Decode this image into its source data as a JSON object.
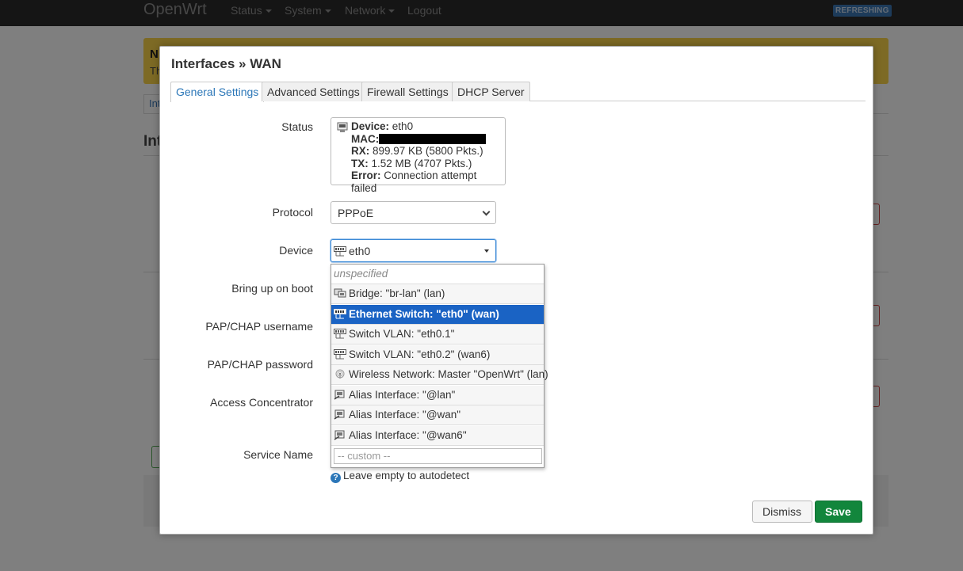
{
  "navbar": {
    "brand": "OpenWrt",
    "items": [
      {
        "label": "Status",
        "has_caret": true
      },
      {
        "label": "System",
        "has_caret": true
      },
      {
        "label": "Network",
        "has_caret": true
      },
      {
        "label": "Logout",
        "has_caret": false
      }
    ],
    "refresh_badge": "REFRESHING"
  },
  "background": {
    "notice_title": "N",
    "notice_text": "Th",
    "tab_label": "Int",
    "heading": "Int"
  },
  "modal": {
    "title": "Interfaces » WAN",
    "tabs": [
      {
        "label": "General Settings",
        "active": true
      },
      {
        "label": "Advanced Settings",
        "active": false
      },
      {
        "label": "Firewall Settings",
        "active": false
      },
      {
        "label": "DHCP Server",
        "active": false
      }
    ],
    "status": {
      "label": "Status",
      "device_key": "Device:",
      "device_value": "eth0",
      "mac_key": "MAC:",
      "rx_key": "RX:",
      "rx_value": "899.97 KB (5800 Pkts.)",
      "tx_key": "TX:",
      "tx_value": "1.52 MB (4707 Pkts.)",
      "error_key": "Error:",
      "error_value": "Connection attempt failed"
    },
    "protocol": {
      "label": "Protocol",
      "value": "PPPoE"
    },
    "device": {
      "label": "Device",
      "value": "eth0"
    },
    "form_labels": {
      "bring_up": "Bring up on boot",
      "username": "PAP/CHAP username",
      "password": "PAP/CHAP password",
      "concentrator": "Access Concentrator",
      "service": "Service Name"
    },
    "dropdown": {
      "items": [
        {
          "label": "unspecified",
          "icon": "none",
          "state": "placeholder"
        },
        {
          "label": "Bridge: \"br-lan\" (lan)",
          "icon": "bridge-icon",
          "state": "normal"
        },
        {
          "label": "Ethernet Switch: \"eth0\" (wan)",
          "icon": "ethernet-switch-icon",
          "state": "selected"
        },
        {
          "label": "Switch VLAN: \"eth0.1\"",
          "icon": "switch-vlan-icon",
          "state": "normal"
        },
        {
          "label": "Switch VLAN: \"eth0.2\" (wan6)",
          "icon": "switch-vlan-icon",
          "state": "normal"
        },
        {
          "label": "Wireless Network: Master \"OpenWrt\" (lan)",
          "icon": "wireless-icon",
          "state": "normal"
        },
        {
          "label": "Alias Interface: \"@lan\"",
          "icon": "alias-icon",
          "state": "normal"
        },
        {
          "label": "Alias Interface: \"@wan\"",
          "icon": "alias-icon",
          "state": "normal"
        },
        {
          "label": "Alias Interface: \"@wan6\"",
          "icon": "alias-icon",
          "state": "normal"
        }
      ],
      "custom_placeholder": "-- custom --"
    },
    "hint": "Leave empty to autodetect",
    "buttons": {
      "dismiss": "Dismiss",
      "save": "Save"
    }
  },
  "colors": {
    "accent": "#2c77b8",
    "selected": "#1a63c4",
    "save": "#12863c"
  }
}
